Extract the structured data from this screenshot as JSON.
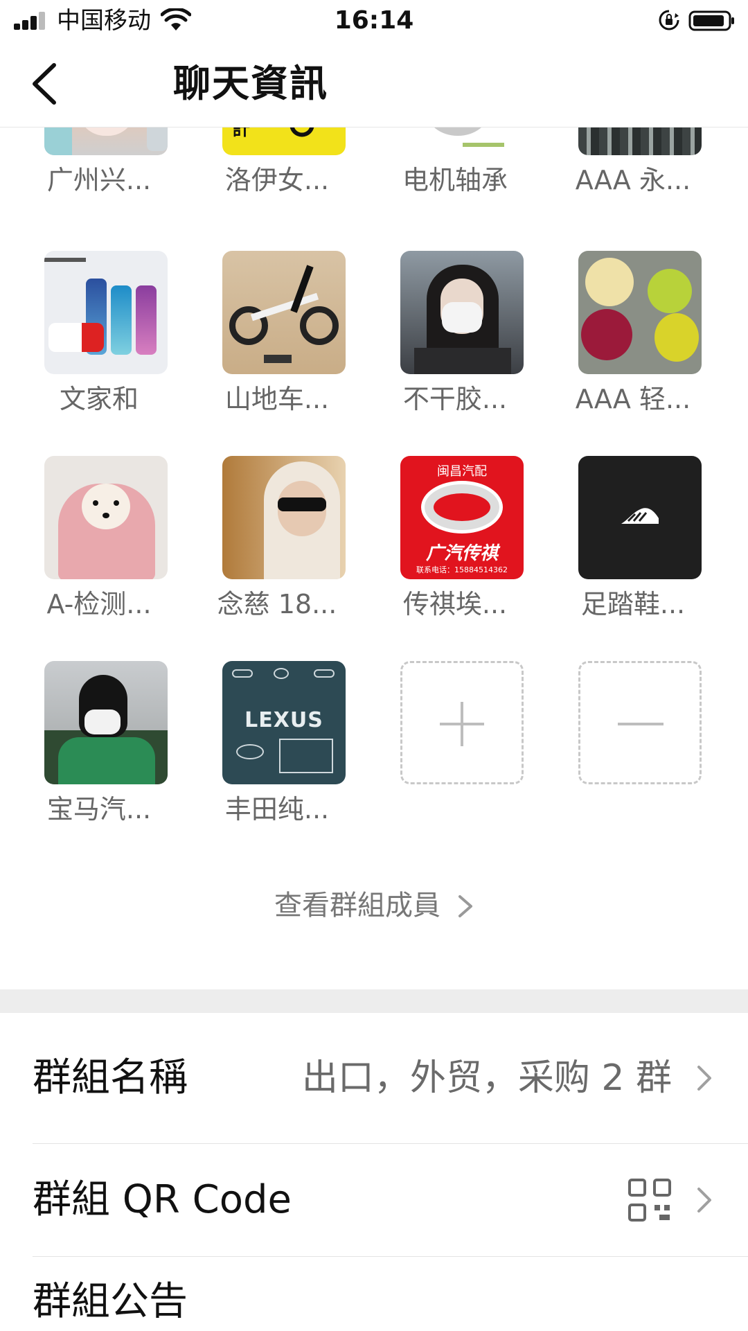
{
  "status_bar": {
    "carrier": "中国移动",
    "time": "16:14",
    "icons": [
      "signal-icon",
      "wifi-icon",
      "rotation-lock-icon",
      "battery-icon"
    ]
  },
  "nav": {
    "title": "聊天資訊",
    "back_icon": "chevron-left-icon"
  },
  "members": [
    {
      "name": "广州兴...",
      "avatar": "partial-photo-smiling-person"
    },
    {
      "name": "洛伊女...",
      "avatar": "yellow-logo-design"
    },
    {
      "name": "电机轴承",
      "avatar": "bearing-photo"
    },
    {
      "name": "AAA 永...",
      "avatar": "dark-textured-product"
    },
    {
      "name": "文家和",
      "avatar": "water-bottles-photo"
    },
    {
      "name": "山地车...",
      "avatar": "mountain-bike-photo"
    },
    {
      "name": "不干胶...",
      "avatar": "masked-woman-photo"
    },
    {
      "name": "AAA 轻...",
      "avatar": "colorful-chairs-photo"
    },
    {
      "name": "A-检测...",
      "avatar": "dog-in-blanket-photo"
    },
    {
      "name": "念慈 18...",
      "avatar": "woman-sunglasses-photo"
    },
    {
      "name": "传祺埃...",
      "avatar": "gac-trumpchi-logo"
    },
    {
      "name": "足踏鞋...",
      "avatar": "black-sneaker-logo"
    },
    {
      "name": "宝马汽...",
      "avatar": "masked-person-outdoors-photo"
    },
    {
      "name": "丰田纯...",
      "avatar": "lexus-logo"
    }
  ],
  "gac_logo": {
    "top": "闽昌汽配",
    "bottom": "广汽传祺",
    "phone": "联系电话：15884514362"
  },
  "lexus_logo": {
    "text": "LEXUS"
  },
  "add_member_icon": "plus-icon",
  "remove_member_icon": "minus-icon",
  "view_members_label": "查看群組成員",
  "settings": {
    "group_name": {
      "label": "群組名稱",
      "value": "出口，外贸，采购 2 群"
    },
    "qr_code": {
      "label": "群組 QR Code",
      "icon": "qr-code-icon"
    },
    "announcement": {
      "label": "群組公告"
    }
  },
  "colors": {
    "background": "#ffffff",
    "section_gap": "#ededed",
    "name_gray": "#666666",
    "gac_red": "#e1141e"
  }
}
